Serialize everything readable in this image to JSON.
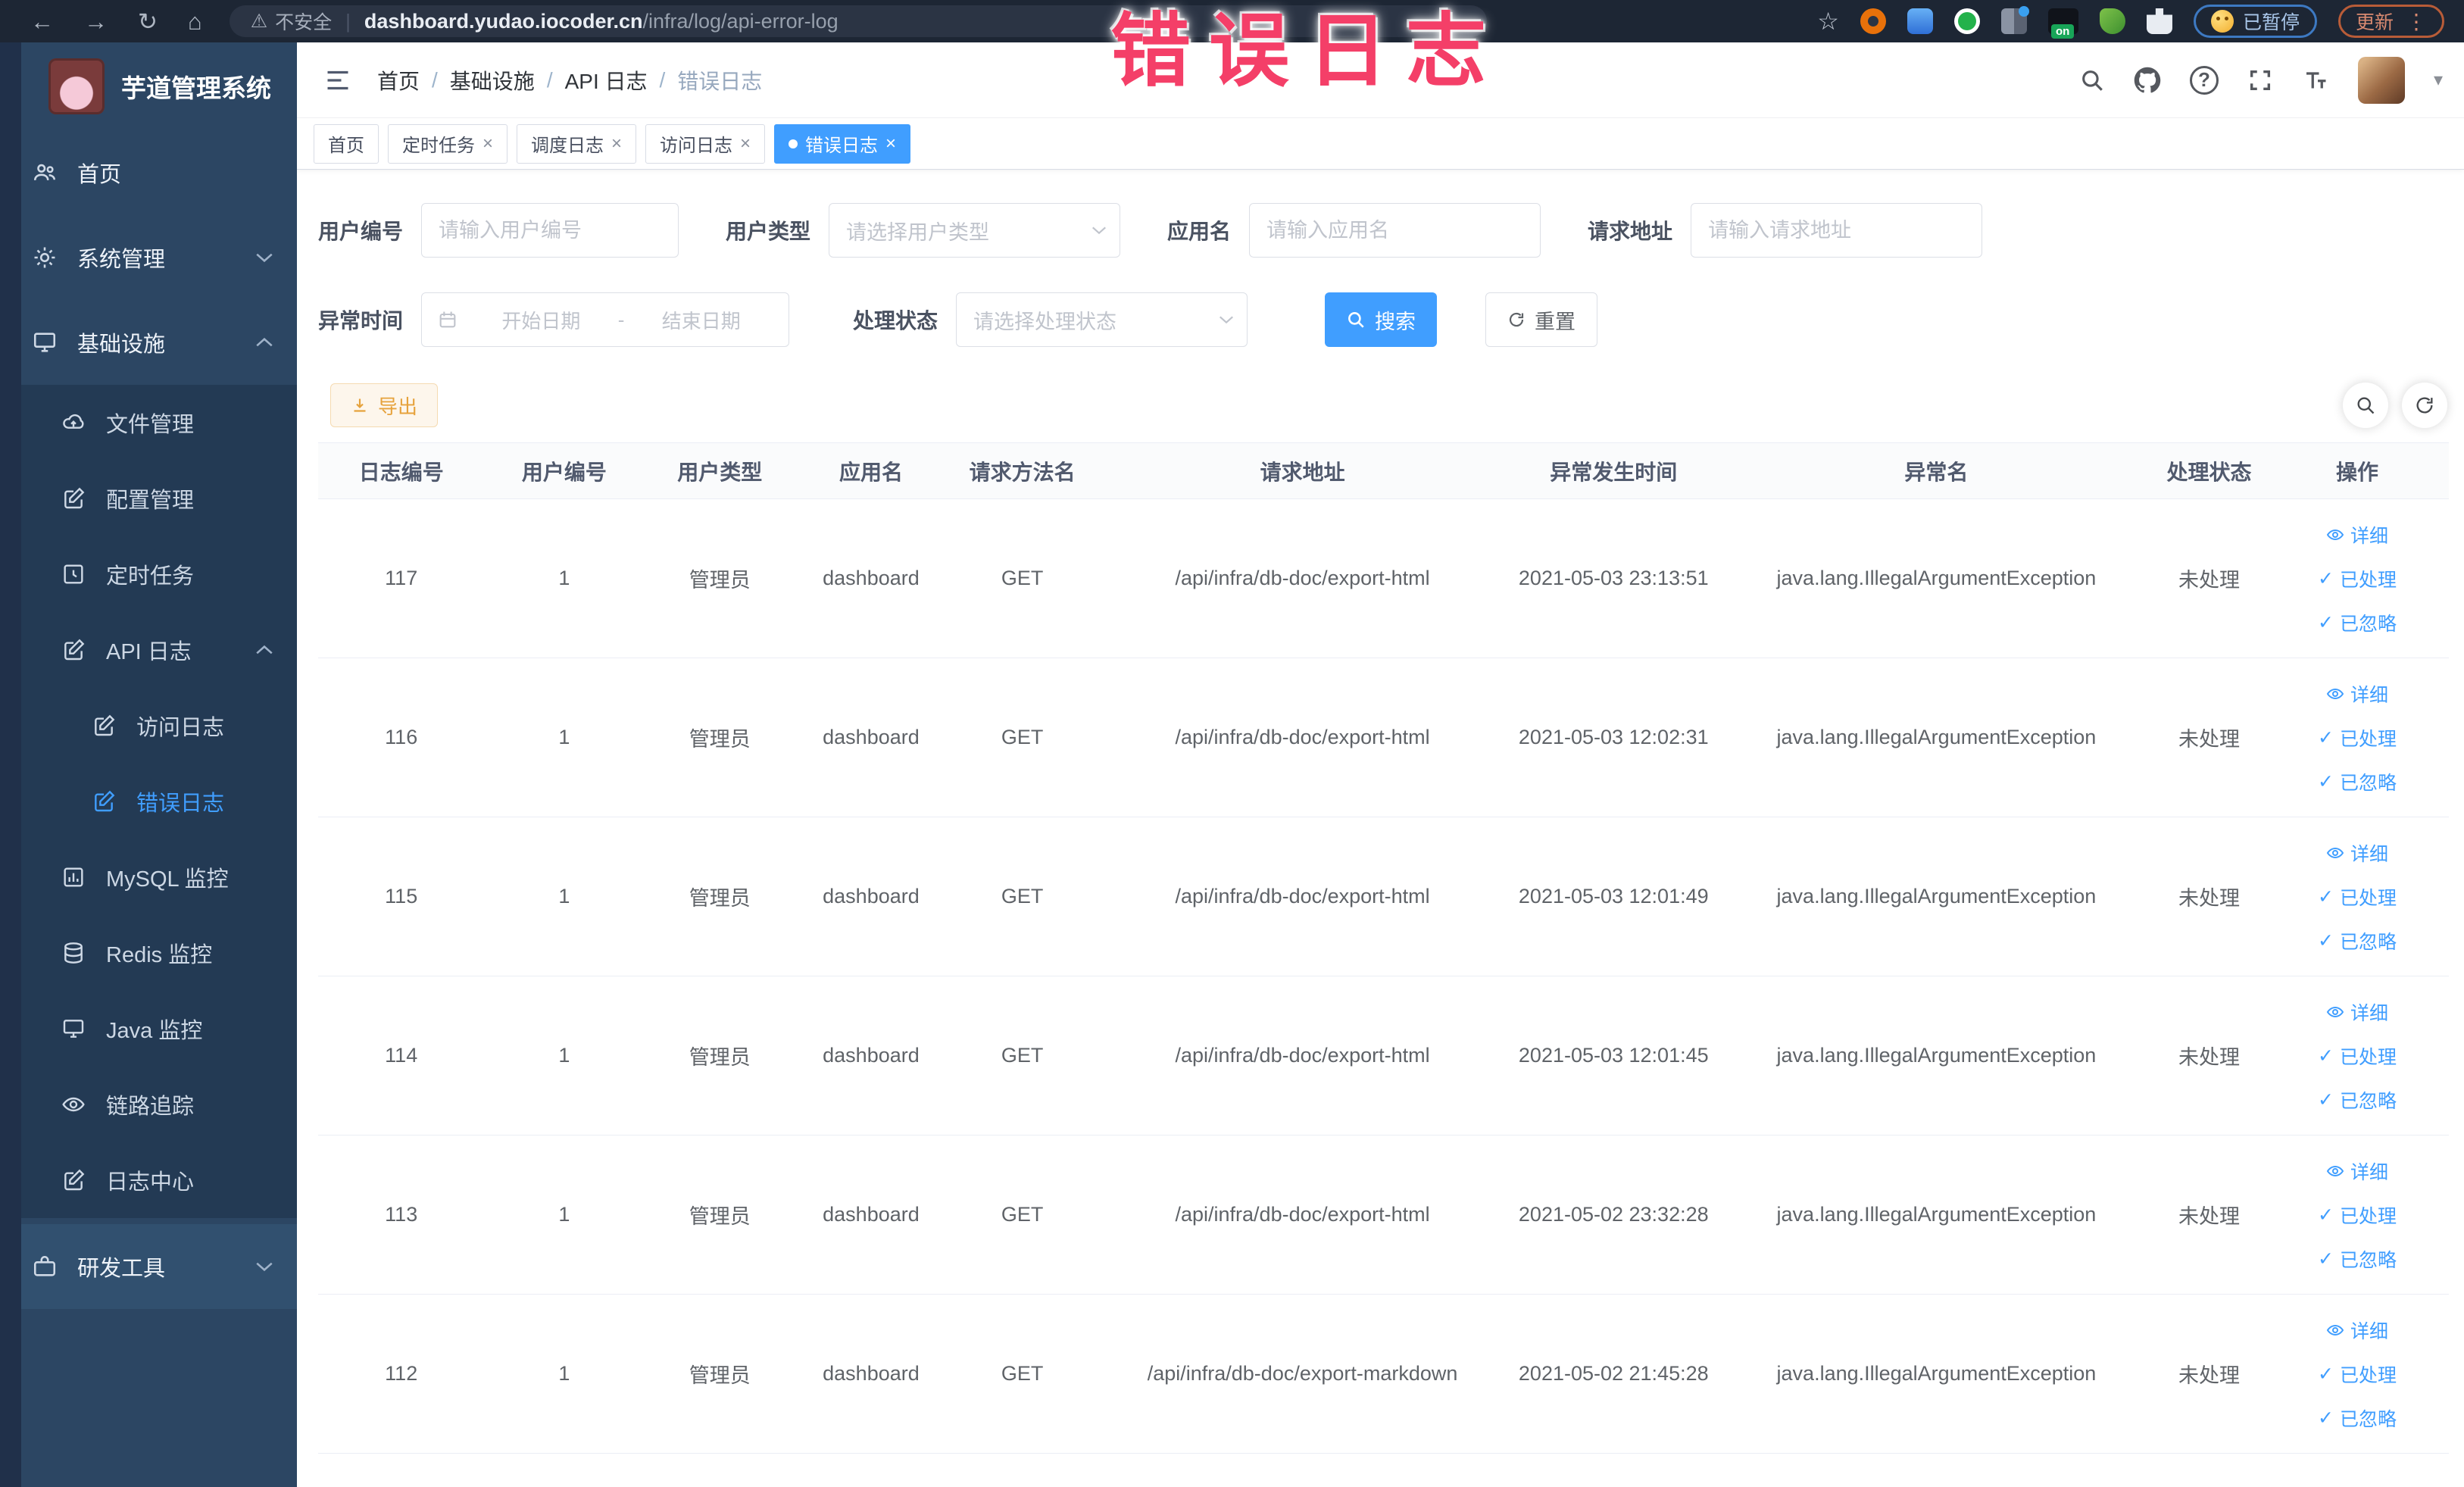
{
  "annotation": {
    "text": "错误日志"
  },
  "glyphs": {
    "back": "←",
    "forward": "→",
    "reload": "↻",
    "home": "⌂",
    "warning": "⚠",
    "star": "☆",
    "kebab": "⋮",
    "close": "×",
    "question": "?",
    "check": "✓",
    "on_badge": "on",
    "divider": "|",
    "dash": "-"
  },
  "browser": {
    "security_label": "不安全",
    "url_domain": "dashboard.yudao.iocoder.cn",
    "url_path": "/infra/log/api-error-log",
    "paused_pill": "已暂停",
    "update_pill": "更新"
  },
  "sidebar": {
    "title": "芋道管理系统",
    "menu": [
      {
        "label": "首页"
      },
      {
        "label": "系统管理"
      },
      {
        "label": "基础设施",
        "children": [
          {
            "label": "文件管理"
          },
          {
            "label": "配置管理"
          },
          {
            "label": "定时任务"
          },
          {
            "label": "API 日志",
            "children": [
              {
                "label": "访问日志"
              },
              {
                "label": "错误日志"
              }
            ]
          },
          {
            "label": "MySQL 监控"
          },
          {
            "label": "Redis 监控"
          },
          {
            "label": "Java 监控"
          },
          {
            "label": "链路追踪"
          },
          {
            "label": "日志中心"
          }
        ]
      },
      {
        "label": "研发工具"
      }
    ]
  },
  "breadcrumb": [
    "首页",
    "基础设施",
    "API 日志",
    "错误日志"
  ],
  "tabs": [
    {
      "label": "首页"
    },
    {
      "label": "定时任务"
    },
    {
      "label": "调度日志"
    },
    {
      "label": "访问日志"
    },
    {
      "label": "错误日志"
    }
  ],
  "filters": {
    "user_id_label": "用户编号",
    "user_id_placeholder": "请输入用户编号",
    "user_type_label": "用户类型",
    "user_type_placeholder": "请选择用户类型",
    "app_name_label": "应用名",
    "app_name_placeholder": "请输入应用名",
    "request_url_label": "请求地址",
    "request_url_placeholder": "请输入请求地址",
    "exception_time_label": "异常时间",
    "start_date_placeholder": "开始日期",
    "end_date_placeholder": "结束日期",
    "process_status_label": "处理状态",
    "process_status_placeholder": "请选择处理状态",
    "search_button": "搜索",
    "reset_button": "重置"
  },
  "toolbar": {
    "export_button": "导出"
  },
  "table": {
    "headers": [
      "日志编号",
      "用户编号",
      "用户类型",
      "应用名",
      "请求方法名",
      "请求地址",
      "异常发生时间",
      "异常名",
      "处理状态",
      "操作"
    ],
    "row_actions": [
      "详细",
      "已处理",
      "已忽略"
    ],
    "rows": [
      {
        "log_id": "117",
        "user_id": "1",
        "user_type": "管理员",
        "app_name": "dashboard",
        "method": "GET",
        "request_url": "/api/infra/db-doc/export-html",
        "time": "2021-05-03 23:13:51",
        "exception": "java.lang.IllegalArgumentException",
        "status": "未处理"
      },
      {
        "log_id": "116",
        "user_id": "1",
        "user_type": "管理员",
        "app_name": "dashboard",
        "method": "GET",
        "request_url": "/api/infra/db-doc/export-html",
        "time": "2021-05-03 12:02:31",
        "exception": "java.lang.IllegalArgumentException",
        "status": "未处理"
      },
      {
        "log_id": "115",
        "user_id": "1",
        "user_type": "管理员",
        "app_name": "dashboard",
        "method": "GET",
        "request_url": "/api/infra/db-doc/export-html",
        "time": "2021-05-03 12:01:49",
        "exception": "java.lang.IllegalArgumentException",
        "status": "未处理"
      },
      {
        "log_id": "114",
        "user_id": "1",
        "user_type": "管理员",
        "app_name": "dashboard",
        "method": "GET",
        "request_url": "/api/infra/db-doc/export-html",
        "time": "2021-05-03 12:01:45",
        "exception": "java.lang.IllegalArgumentException",
        "status": "未处理"
      },
      {
        "log_id": "113",
        "user_id": "1",
        "user_type": "管理员",
        "app_name": "dashboard",
        "method": "GET",
        "request_url": "/api/infra/db-doc/export-html",
        "time": "2021-05-02 23:32:28",
        "exception": "java.lang.IllegalArgumentException",
        "status": "未处理"
      },
      {
        "log_id": "112",
        "user_id": "1",
        "user_type": "管理员",
        "app_name": "dashboard",
        "method": "GET",
        "request_url": "/api/infra/db-doc/export-markdown",
        "time": "2021-05-02 21:45:28",
        "exception": "java.lang.IllegalArgumentException",
        "status": "未处理"
      }
    ]
  },
  "colors": {
    "accent": "#409EFF",
    "warning_text": "#e6a23c",
    "annotation": "#f43f68",
    "sidebar_bg": "#2c4663",
    "submenu_bg": "#233a54",
    "browser_bar": "#1d2634"
  }
}
